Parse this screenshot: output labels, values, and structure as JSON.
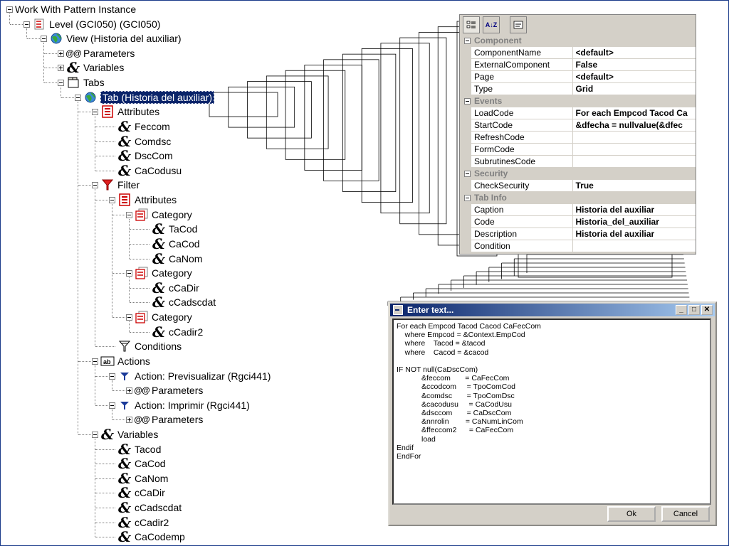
{
  "tree": {
    "nodes": [
      {
        "id": "n0",
        "label": "Work With Pattern Instance",
        "icon": "pattern-instance-icon"
      },
      {
        "id": "n1",
        "label": "Level (GCI050) (GCI050)",
        "icon": "level-icon"
      },
      {
        "id": "n2",
        "label": "View (Historia del auxiliar)",
        "icon": "view-globe-icon"
      },
      {
        "id": "n3",
        "label": "Parameters",
        "icon": "parameters-icon"
      },
      {
        "id": "n4",
        "label": "Variables",
        "icon": "variable-icon"
      },
      {
        "id": "n5",
        "label": "Tabs",
        "icon": "tabs-icon"
      },
      {
        "id": "n6",
        "label": "Tab (Historia del auxiliar)",
        "icon": "tab-globe-icon"
      },
      {
        "id": "n7",
        "label": "Attributes",
        "icon": "attributes-icon"
      },
      {
        "id": "n8",
        "label": "Feccom",
        "icon": "variable-icon"
      },
      {
        "id": "n9",
        "label": "Comdsc",
        "icon": "variable-icon"
      },
      {
        "id": "n10",
        "label": "DscCom",
        "icon": "variable-icon"
      },
      {
        "id": "n11",
        "label": "CaCodusu",
        "icon": "variable-icon"
      },
      {
        "id": "n12",
        "label": "Filter",
        "icon": "filter-icon"
      },
      {
        "id": "n13",
        "label": "Attributes",
        "icon": "attributes-icon"
      },
      {
        "id": "n14",
        "label": "Category",
        "icon": "category-icon"
      },
      {
        "id": "n15",
        "label": "TaCod",
        "icon": "variable-icon"
      },
      {
        "id": "n16",
        "label": "CaCod",
        "icon": "variable-icon"
      },
      {
        "id": "n17",
        "label": "CaNom",
        "icon": "variable-icon"
      },
      {
        "id": "n18",
        "label": "Category",
        "icon": "category-icon"
      },
      {
        "id": "n19",
        "label": "cCaDir",
        "icon": "variable-icon"
      },
      {
        "id": "n20",
        "label": "cCadscdat",
        "icon": "variable-icon"
      },
      {
        "id": "n21",
        "label": "Category",
        "icon": "category-icon"
      },
      {
        "id": "n22",
        "label": "cCadir2",
        "icon": "variable-icon"
      },
      {
        "id": "n23",
        "label": "Conditions",
        "icon": "conditions-icon"
      },
      {
        "id": "n24",
        "label": "Actions",
        "icon": "actions-icon"
      },
      {
        "id": "n25",
        "label": "Action: Previsualizar (Rgci441)",
        "icon": "action-icon"
      },
      {
        "id": "n26",
        "label": "Parameters",
        "icon": "parameters-icon"
      },
      {
        "id": "n27",
        "label": "Action: Imprimir (Rgci441)",
        "icon": "action-icon"
      },
      {
        "id": "n28",
        "label": "Parameters",
        "icon": "parameters-icon"
      },
      {
        "id": "n29",
        "label": "Variables",
        "icon": "variable-icon"
      },
      {
        "id": "n30",
        "label": "Tacod",
        "icon": "variable-icon"
      },
      {
        "id": "n31",
        "label": "CaCod",
        "icon": "variable-icon"
      },
      {
        "id": "n32",
        "label": "CaNom",
        "icon": "variable-icon"
      },
      {
        "id": "n33",
        "label": "cCaDir",
        "icon": "variable-icon"
      },
      {
        "id": "n34",
        "label": "cCadscdat",
        "icon": "variable-icon"
      },
      {
        "id": "n35",
        "label": "cCadir2",
        "icon": "variable-icon"
      },
      {
        "id": "n36",
        "label": "CaCodemp",
        "icon": "variable-icon"
      }
    ],
    "params_prefix": "@@"
  },
  "properties": {
    "toolbar": {
      "az_label": "A↓Z"
    },
    "categories": [
      {
        "name": "Component",
        "rows": [
          {
            "name": "ComponentName",
            "value": "<default>"
          },
          {
            "name": "ExternalComponent",
            "value": "False"
          },
          {
            "name": "Page",
            "value": "<default>"
          },
          {
            "name": "Type",
            "value": "Grid"
          }
        ]
      },
      {
        "name": "Events",
        "rows": [
          {
            "name": "LoadCode",
            "value": "For each Empcod Tacod Ca"
          },
          {
            "name": "StartCode",
            "value": "&dfecha      = nullvalue(&dfec"
          },
          {
            "name": "RefreshCode",
            "value": ""
          },
          {
            "name": "FormCode",
            "value": ""
          },
          {
            "name": "SubrutinesCode",
            "value": ""
          }
        ]
      },
      {
        "name": "Security",
        "rows": [
          {
            "name": "CheckSecurity",
            "value": "True"
          }
        ]
      },
      {
        "name": "Tab Info",
        "rows": [
          {
            "name": "Caption",
            "value": "Historia del auxiliar"
          },
          {
            "name": "Code",
            "value": "Historia_del_auxiliar"
          },
          {
            "name": "Description",
            "value": "Historia del auxiliar"
          },
          {
            "name": "Condition",
            "value": ""
          }
        ]
      }
    ]
  },
  "dialog": {
    "title": "Enter text...",
    "text": "For each Empcod Tacod Cacod CaFecCom\n    where Empcod = &Context.EmpCod\n    where    Tacod = &tacod\n    where    Cacod = &cacod\n\nIF NOT null(CaDscCom)\n            &feccom       = CaFecCom\n            &ccodcom     = TpoComCod\n            &comdsc       = TpoComDsc\n            &cacodusu     = CaCodUsu\n            &dsccom       = CaDscCom\n            &nnrolin        = CaNumLinCom\n            &ffeccom2      = CaFecCom\n            load\nEndif\nEndFor",
    "ok_label": "Ok",
    "cancel_label": "Cancel",
    "min_glyph": "_",
    "max_glyph": "□",
    "close_glyph": "✕"
  }
}
